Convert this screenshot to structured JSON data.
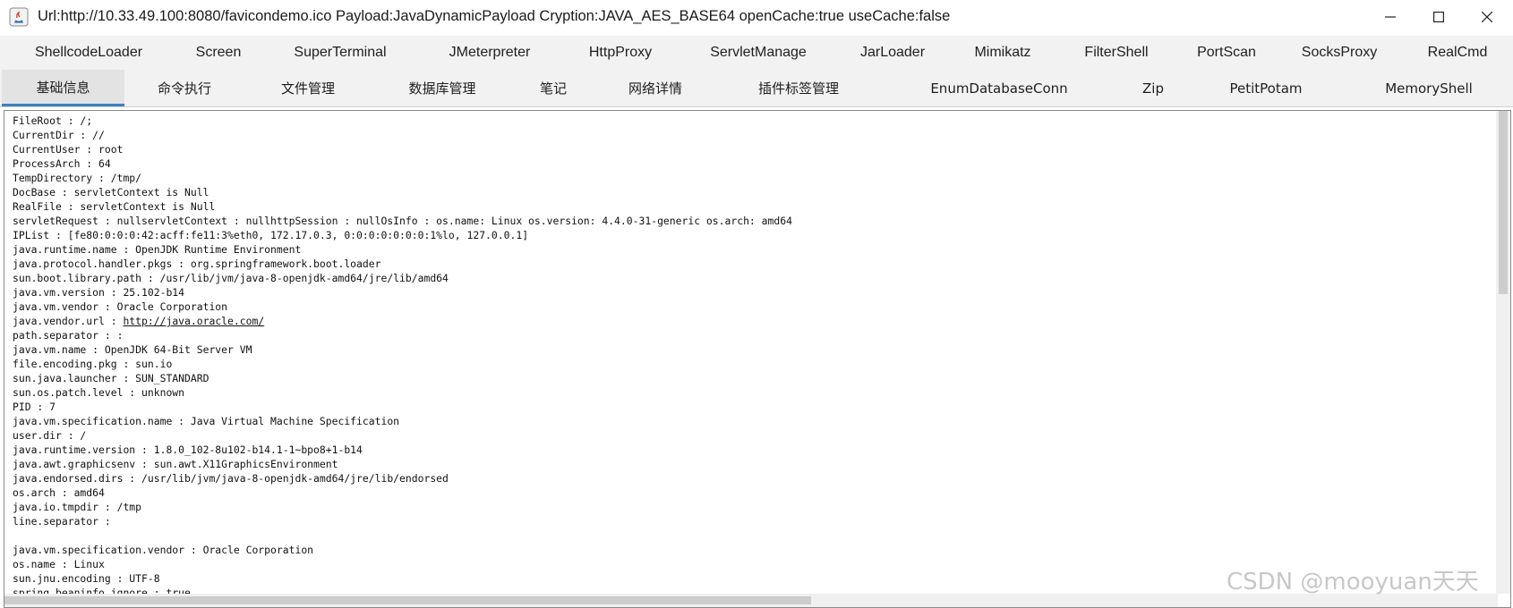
{
  "window": {
    "title": "Url:http://10.33.49.100:8080/favicondemo.ico Payload:JavaDynamicPayload Cryption:JAVA_AES_BASE64 openCache:true useCache:false",
    "minimize_glyph": "—",
    "maximize_glyph": "☐",
    "close_glyph": "✕",
    "icon": "java-app-icon"
  },
  "tabs_row1": [
    "ShellcodeLoader",
    "Screen",
    "SuperTerminal",
    "JMeterpreter",
    "HttpProxy",
    "ServletManage",
    "JarLoader",
    "Mimikatz",
    "FilterShell",
    "PortScan",
    "SocksProxy",
    "RealCmd"
  ],
  "tabs_row2": [
    "基础信息",
    "命令执行",
    "文件管理",
    "数据库管理",
    "笔记",
    "网络详情",
    "插件标签管理",
    "EnumDatabaseConn",
    "Zip",
    "PetitPotam",
    "MemoryShell"
  ],
  "active_tab": "基础信息",
  "scroll": {
    "vertical_position": 0,
    "vertical_visible_fraction": 0.38,
    "horizontal_position": 0,
    "horizontal_visible_fraction": 0.54
  },
  "info_lines": [
    "FileRoot : /;",
    "CurrentDir : //",
    "CurrentUser : root",
    "ProcessArch : 64",
    "TempDirectory : /tmp/",
    "DocBase : servletContext is Null",
    "RealFile : servletContext is Null",
    "servletRequest : nullservletContext : nullhttpSession : nullOsInfo : os.name: Linux os.version: 4.4.0-31-generic os.arch: amd64",
    "IPList : [fe80:0:0:0:42:acff:fe11:3%eth0, 172.17.0.3, 0:0:0:0:0:0:0:1%lo, 127.0.0.1]",
    "java.runtime.name : OpenJDK Runtime Environment",
    "java.protocol.handler.pkgs : org.springframework.boot.loader",
    "sun.boot.library.path : /usr/lib/jvm/java-8-openjdk-amd64/jre/lib/amd64",
    "java.vm.version : 25.102-b14",
    "java.vm.vendor : Oracle Corporation",
    "java.vendor.url : ",
    "path.separator : :",
    "java.vm.name : OpenJDK 64-Bit Server VM",
    "file.encoding.pkg : sun.io",
    "sun.java.launcher : SUN_STANDARD",
    "sun.os.patch.level : unknown",
    "PID : 7",
    "java.vm.specification.name : Java Virtual Machine Specification",
    "user.dir : /",
    "java.runtime.version : 1.8.0_102-8u102-b14.1-1~bpo8+1-b14",
    "java.awt.graphicsenv : sun.awt.X11GraphicsEnvironment",
    "java.endorsed.dirs : /usr/lib/jvm/java-8-openjdk-amd64/jre/lib/endorsed",
    "os.arch : amd64",
    "java.io.tmpdir : /tmp",
    "line.separator : ",
    "",
    "java.vm.specification.vendor : Oracle Corporation",
    "os.name : Linux",
    "sun.jnu.encoding : UTF-8",
    "spring.beaninfo.ignore : true"
  ],
  "vendor_url_link": "http://java.oracle.com/",
  "watermark": "CSDN @mooyuan天天",
  "colors": {
    "active_tab_underline": "#3d7fc2",
    "tab_bar": "#f2f2f2"
  }
}
